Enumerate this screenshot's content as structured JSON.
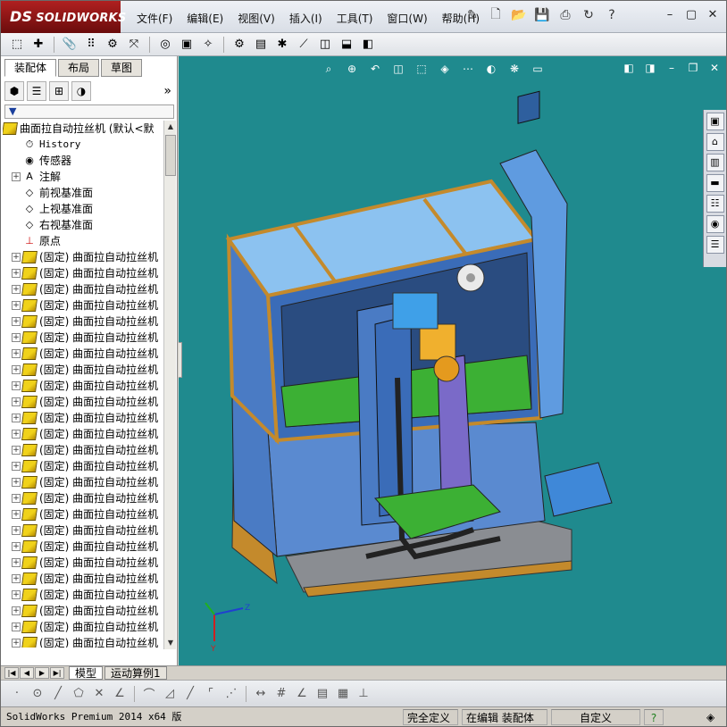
{
  "app": {
    "logo_prefix": "DS",
    "logo_text": "SOLIDWORKS"
  },
  "menu": {
    "items": [
      "文件(F)",
      "编辑(E)",
      "视图(V)",
      "插入(I)",
      "工具(T)",
      "窗口(W)",
      "帮助(H)"
    ]
  },
  "left_panel": {
    "tabs": [
      "装配体",
      "布局",
      "草图"
    ],
    "active_tab": "装配体",
    "filter_icon": "filter-icon",
    "tree": {
      "root_label": "曲面拉自动拉丝机  (默认<默",
      "fixed_items": [
        {
          "label": "History",
          "icon": "history-icon"
        },
        {
          "label": "传感器",
          "icon": "sensor-icon"
        },
        {
          "label": "注解",
          "icon": "annotation-icon",
          "expandable": true
        },
        {
          "label": "前视基准面",
          "icon": "plane-icon"
        },
        {
          "label": "上视基准面",
          "icon": "plane-icon"
        },
        {
          "label": "右视基准面",
          "icon": "plane-icon"
        },
        {
          "label": "原点",
          "icon": "origin-icon"
        }
      ],
      "component_label": "(固定) 曲面拉自动拉丝机",
      "component_count": 25
    }
  },
  "bottom_tabs": [
    "模型",
    "运动算例1"
  ],
  "statusbar": {
    "product": "SolidWorks Premium 2014 x64 版",
    "status1": "完全定义",
    "status2": "在编辑 装配体",
    "units": "自定义",
    "help": "?"
  },
  "viewport": {
    "background": "#1f8a8e",
    "axes": {
      "y": "Y",
      "z": "Z"
    }
  }
}
